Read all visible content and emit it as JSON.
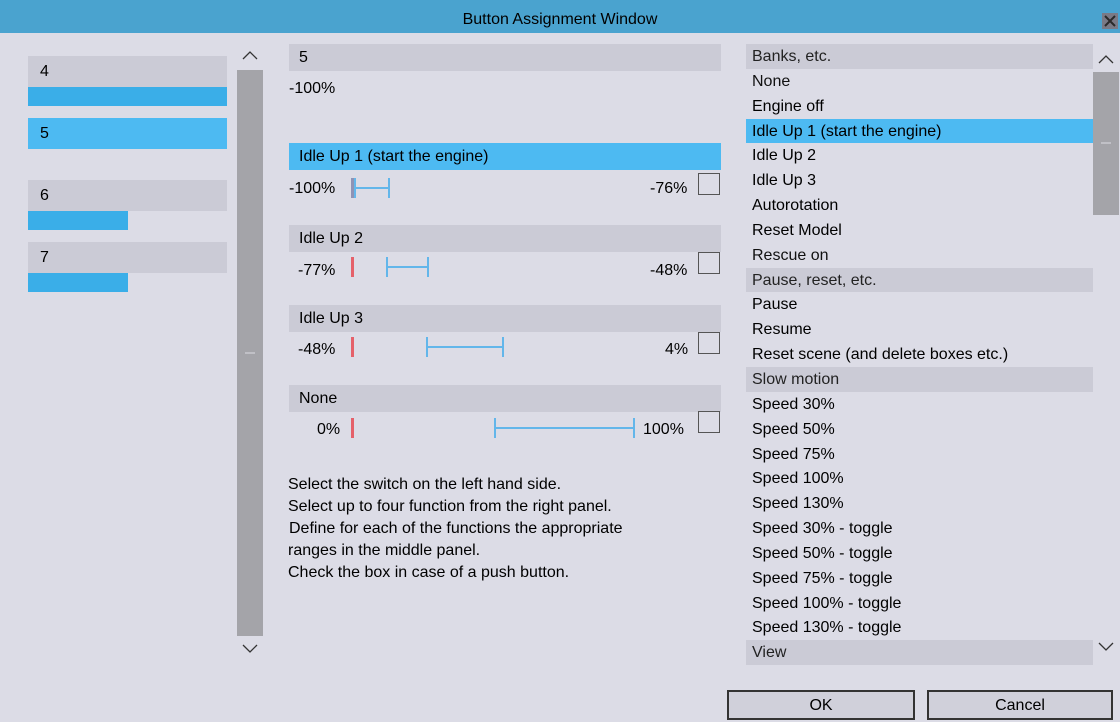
{
  "window": {
    "title": "Button Assignment Window"
  },
  "switches": [
    {
      "label": "4",
      "bar_fraction": 1.0
    },
    {
      "label": "5",
      "selected": true
    },
    {
      "label": "6",
      "bar_fraction": 0.5
    },
    {
      "label": "7",
      "bar_fraction": 0.5
    }
  ],
  "middle": {
    "switch_title": "5",
    "switch_value": "-100%",
    "functions": [
      {
        "name": "Idle Up 1 (start the engine)",
        "min": "-100%",
        "max": "-76%",
        "selected": true,
        "push_button": false
      },
      {
        "name": "Idle Up 2",
        "min": "-77%",
        "max": "-48%",
        "selected": false,
        "push_button": false
      },
      {
        "name": "Idle Up 3",
        "min": "-48%",
        "max": "4%",
        "selected": false,
        "push_button": false
      },
      {
        "name": "None",
        "min": "0%",
        "max": "100%",
        "selected": false,
        "push_button": false
      }
    ],
    "instructions": [
      "Select the switch on the left hand side.",
      "Select up to four function from the right panel.",
      "Define for each of the functions the appropriate",
      "ranges in the middle panel.",
      "Check the box in case of a push button."
    ]
  },
  "function_list": [
    {
      "label": "Banks, etc.",
      "kind": "category"
    },
    {
      "label": "None",
      "kind": "plain"
    },
    {
      "label": "Engine off",
      "kind": "item"
    },
    {
      "label": "Idle Up 1 (start the engine)",
      "kind": "selected"
    },
    {
      "label": "Idle Up 2",
      "kind": "item"
    },
    {
      "label": "Idle Up 3",
      "kind": "item"
    },
    {
      "label": "Autorotation",
      "kind": "item"
    },
    {
      "label": "Reset Model",
      "kind": "item"
    },
    {
      "label": "Rescue on",
      "kind": "plain"
    },
    {
      "label": "Pause, reset, etc.",
      "kind": "category"
    },
    {
      "label": "Pause",
      "kind": "item"
    },
    {
      "label": "Resume",
      "kind": "item"
    },
    {
      "label": "Reset scene (and delete boxes etc.)",
      "kind": "item"
    },
    {
      "label": "Slow motion",
      "kind": "category"
    },
    {
      "label": "Speed 30%",
      "kind": "item"
    },
    {
      "label": "Speed 50%",
      "kind": "item"
    },
    {
      "label": "Speed 75%",
      "kind": "item"
    },
    {
      "label": "Speed 100%",
      "kind": "item"
    },
    {
      "label": "Speed 130%",
      "kind": "item"
    },
    {
      "label": "Speed 30% - toggle",
      "kind": "item"
    },
    {
      "label": "Speed 50% - toggle",
      "kind": "item"
    },
    {
      "label": "Speed 75% - toggle",
      "kind": "item"
    },
    {
      "label": "Speed 100% - toggle",
      "kind": "item"
    },
    {
      "label": "Speed 130% - toggle",
      "kind": "item"
    },
    {
      "label": "View",
      "kind": "category"
    }
  ],
  "buttons": {
    "ok": "OK",
    "cancel": "Cancel"
  },
  "icons": {
    "close": "close-icon",
    "scroll_up": "chevron-up-icon",
    "scroll_down": "chevron-down-icon"
  },
  "colors": {
    "title_bar": "#4aa3cf",
    "selection": "#4dbaf2",
    "bar": "#3aaee8",
    "range": "#63b6ea",
    "min_marker": "#e5616a"
  }
}
